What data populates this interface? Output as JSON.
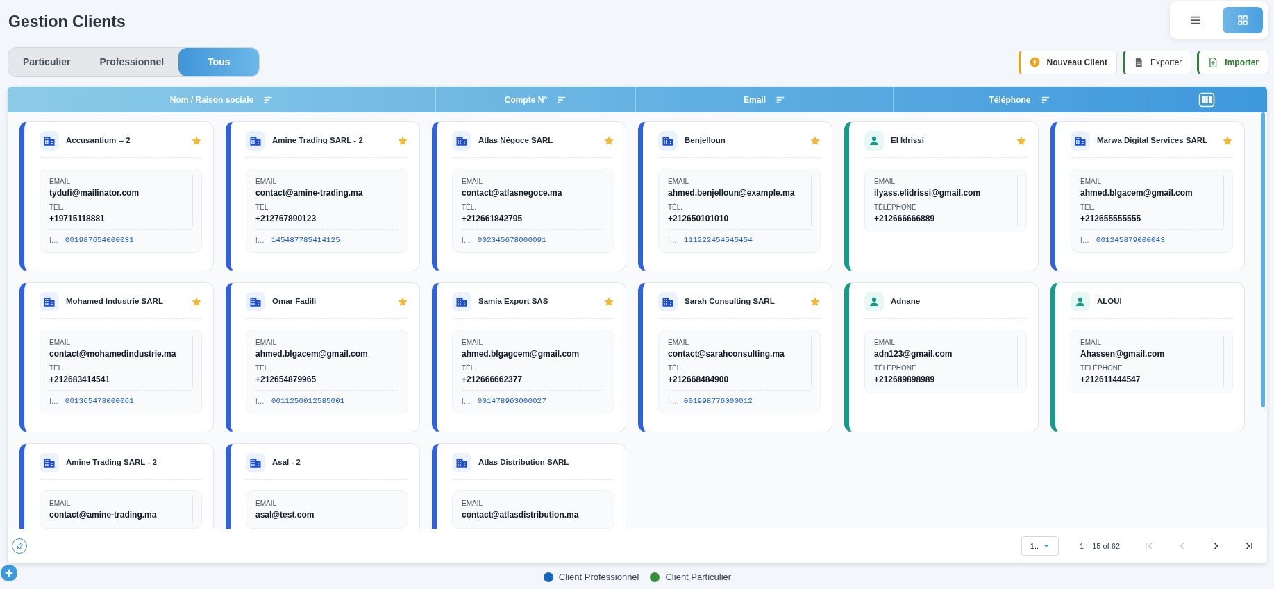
{
  "title": "Gestion Clients",
  "view_toggle": [
    {
      "kind": "list",
      "selected": false
    },
    {
      "kind": "grid",
      "selected": true
    }
  ],
  "filter_tabs": [
    {
      "label": "Particulier",
      "selected": false
    },
    {
      "label": "Professionnel",
      "selected": false
    },
    {
      "label": "Tous",
      "selected": true
    }
  ],
  "actions": [
    {
      "kind": "new",
      "label": "Nouveau Client"
    },
    {
      "kind": "export",
      "label": "Exporter"
    },
    {
      "kind": "import",
      "label": "Importer"
    }
  ],
  "table": {
    "columns": [
      "Nom / Raison sociale",
      "Compte N°",
      "Email",
      "Téléphone"
    ]
  },
  "cards": [
    {
      "kind": "professionnel",
      "name": "Accusantium -- 2",
      "favorite": true,
      "email_label": "EMAIL",
      "email": "tydufi@mailinator.com",
      "phone_label": "TÉL.",
      "phone": "+19715118881",
      "account_label": "I…",
      "account": "001987654000031"
    },
    {
      "kind": "professionnel",
      "name": "Amine Trading SARL - 2",
      "favorite": true,
      "email_label": "EMAIL",
      "email": "contact@amine-trading.ma",
      "phone_label": "TÉL.",
      "phone": "+212767890123",
      "account_label": "I…",
      "account": "145487785414125"
    },
    {
      "kind": "professionnel",
      "name": "Atlas Négoce SARL",
      "favorite": true,
      "email_label": "EMAIL",
      "email": "contact@atlasnegoce.ma",
      "phone_label": "TÉL.",
      "phone": "+212661842795",
      "account_label": "I…",
      "account": "002345678000091"
    },
    {
      "kind": "professionnel",
      "name": "Benjelloun",
      "favorite": true,
      "email_label": "EMAIL",
      "email": "ahmed.benjelloun@example.ma",
      "phone_label": "TÉL.",
      "phone": "+212650101010",
      "account_label": "I…",
      "account": "111222454545454"
    },
    {
      "kind": "particulier",
      "name": "El Idrissi",
      "favorite": true,
      "email_label": "EMAIL",
      "email": "ilyass.elidrissi@gmail.com",
      "phone_label": "TÉLÉPHONE",
      "phone": "+212666666889"
    },
    {
      "kind": "professionnel",
      "name": "Marwa Digital Services SARL",
      "favorite": true,
      "email_label": "EMAIL",
      "email": "ahmed.blgacem@gmail.com",
      "phone_label": "TÉL.",
      "phone": "+212655555555",
      "account_label": "I…",
      "account": "001245879000043"
    },
    {
      "kind": "professionnel",
      "name": "Mohamed Industrie SARL",
      "favorite": true,
      "email_label": "EMAIL",
      "email": "contact@mohamedindustrie.ma",
      "phone_label": "TÉL.",
      "phone": "+212683414541",
      "account_label": "I…",
      "account": "001365478000061"
    },
    {
      "kind": "professionnel",
      "name": "Omar Fadili",
      "favorite": true,
      "email_label": "EMAIL",
      "email": "ahmed.blgacem@gmail.com",
      "phone_label": "TÉL.",
      "phone": "+212654879965",
      "account_label": "I…",
      "account": "0011250012585001"
    },
    {
      "kind": "professionnel",
      "name": "Samia Export SAS",
      "favorite": true,
      "email_label": "EMAIL",
      "email": "ahmed.blgagcem@gmail.com",
      "phone_label": "TÉL.",
      "phone": "+212666662377",
      "account_label": "I…",
      "account": "001478963000027"
    },
    {
      "kind": "professionnel",
      "name": "Sarah Consulting SARL",
      "favorite": true,
      "email_label": "EMAIL",
      "email": "contact@sarahconsulting.ma",
      "phone_label": "TÉL.",
      "phone": "+212668484900",
      "account_label": "I…",
      "account": "001998776000012"
    },
    {
      "kind": "particulier",
      "name": "Adnane",
      "favorite": false,
      "email_label": "EMAIL",
      "email": "adn123@gmail.com",
      "phone_label": "TÉLÉPHONE",
      "phone": "+212689898989"
    },
    {
      "kind": "particulier",
      "name": "ALOUI",
      "favorite": false,
      "email_label": "EMAIL",
      "email": "Ahassen@gmail.com",
      "phone_label": "TÉLÉPHONE",
      "phone": "+212611444547"
    },
    {
      "kind": "professionnel",
      "name": "Amine Trading SARL - 2",
      "favorite": false,
      "email_label": "EMAIL",
      "email": "contact@amine-trading.ma"
    },
    {
      "kind": "professionnel",
      "name": "Asal - 2",
      "favorite": false,
      "email_label": "EMAIL",
      "email": "asal@test.com"
    },
    {
      "kind": "professionnel",
      "name": "Atlas Distribution SARL",
      "favorite": false,
      "email_label": "EMAIL",
      "email": "contact@atlasdistribution.ma"
    }
  ],
  "pagination": {
    "page_size": "1..",
    "range": "1 – 15 of 62",
    "first_disabled": true,
    "prev_disabled": true,
    "next_disabled": false,
    "last_disabled": false
  },
  "legend": [
    {
      "label": "Client Professionnel",
      "color": "#1565c0"
    },
    {
      "label": "Client Particulier",
      "color": "#388e3c"
    }
  ]
}
